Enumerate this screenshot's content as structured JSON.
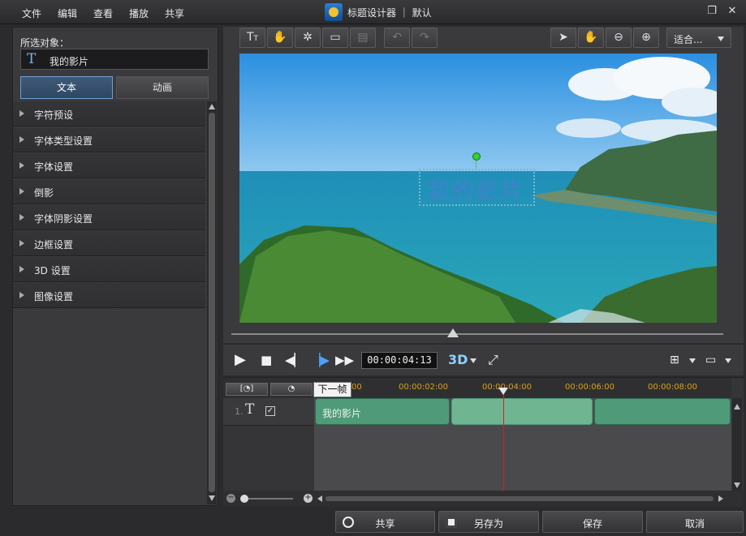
{
  "menu": {
    "items": [
      "文件",
      "编辑",
      "查看",
      "播放",
      "共享"
    ]
  },
  "window": {
    "title": "标题设计器 ｜ 默认"
  },
  "left_panel": {
    "selected_label": "所选对象：",
    "selected_value": "我的影片",
    "tabs": [
      "文本",
      "动画"
    ],
    "properties": [
      "字符预设",
      "字体类型设置",
      "字体设置",
      "倒影",
      "字体阴影设置",
      "边框设置",
      "3D 设置",
      "图像设置"
    ]
  },
  "toolbar": {
    "fit_value": "适合..."
  },
  "preview": {
    "overlay_text": "我的影片"
  },
  "transport": {
    "timecode": "00:00:04:13"
  },
  "timeline": {
    "ticks": [
      "00",
      "00:00:02:00",
      "00:00:04:00",
      "00:00:06:00",
      "00:00:08:00"
    ],
    "tooltip": "下一帧",
    "track_index": "1.",
    "clip_label": "我的影片"
  },
  "footer": {
    "buttons": [
      "共享",
      "另存为",
      "保存",
      "取消"
    ]
  },
  "colors": {
    "accent": "#6f9fd3",
    "clip": "#6fb592",
    "playhead": "#d02020",
    "tick": "#d4a020"
  }
}
